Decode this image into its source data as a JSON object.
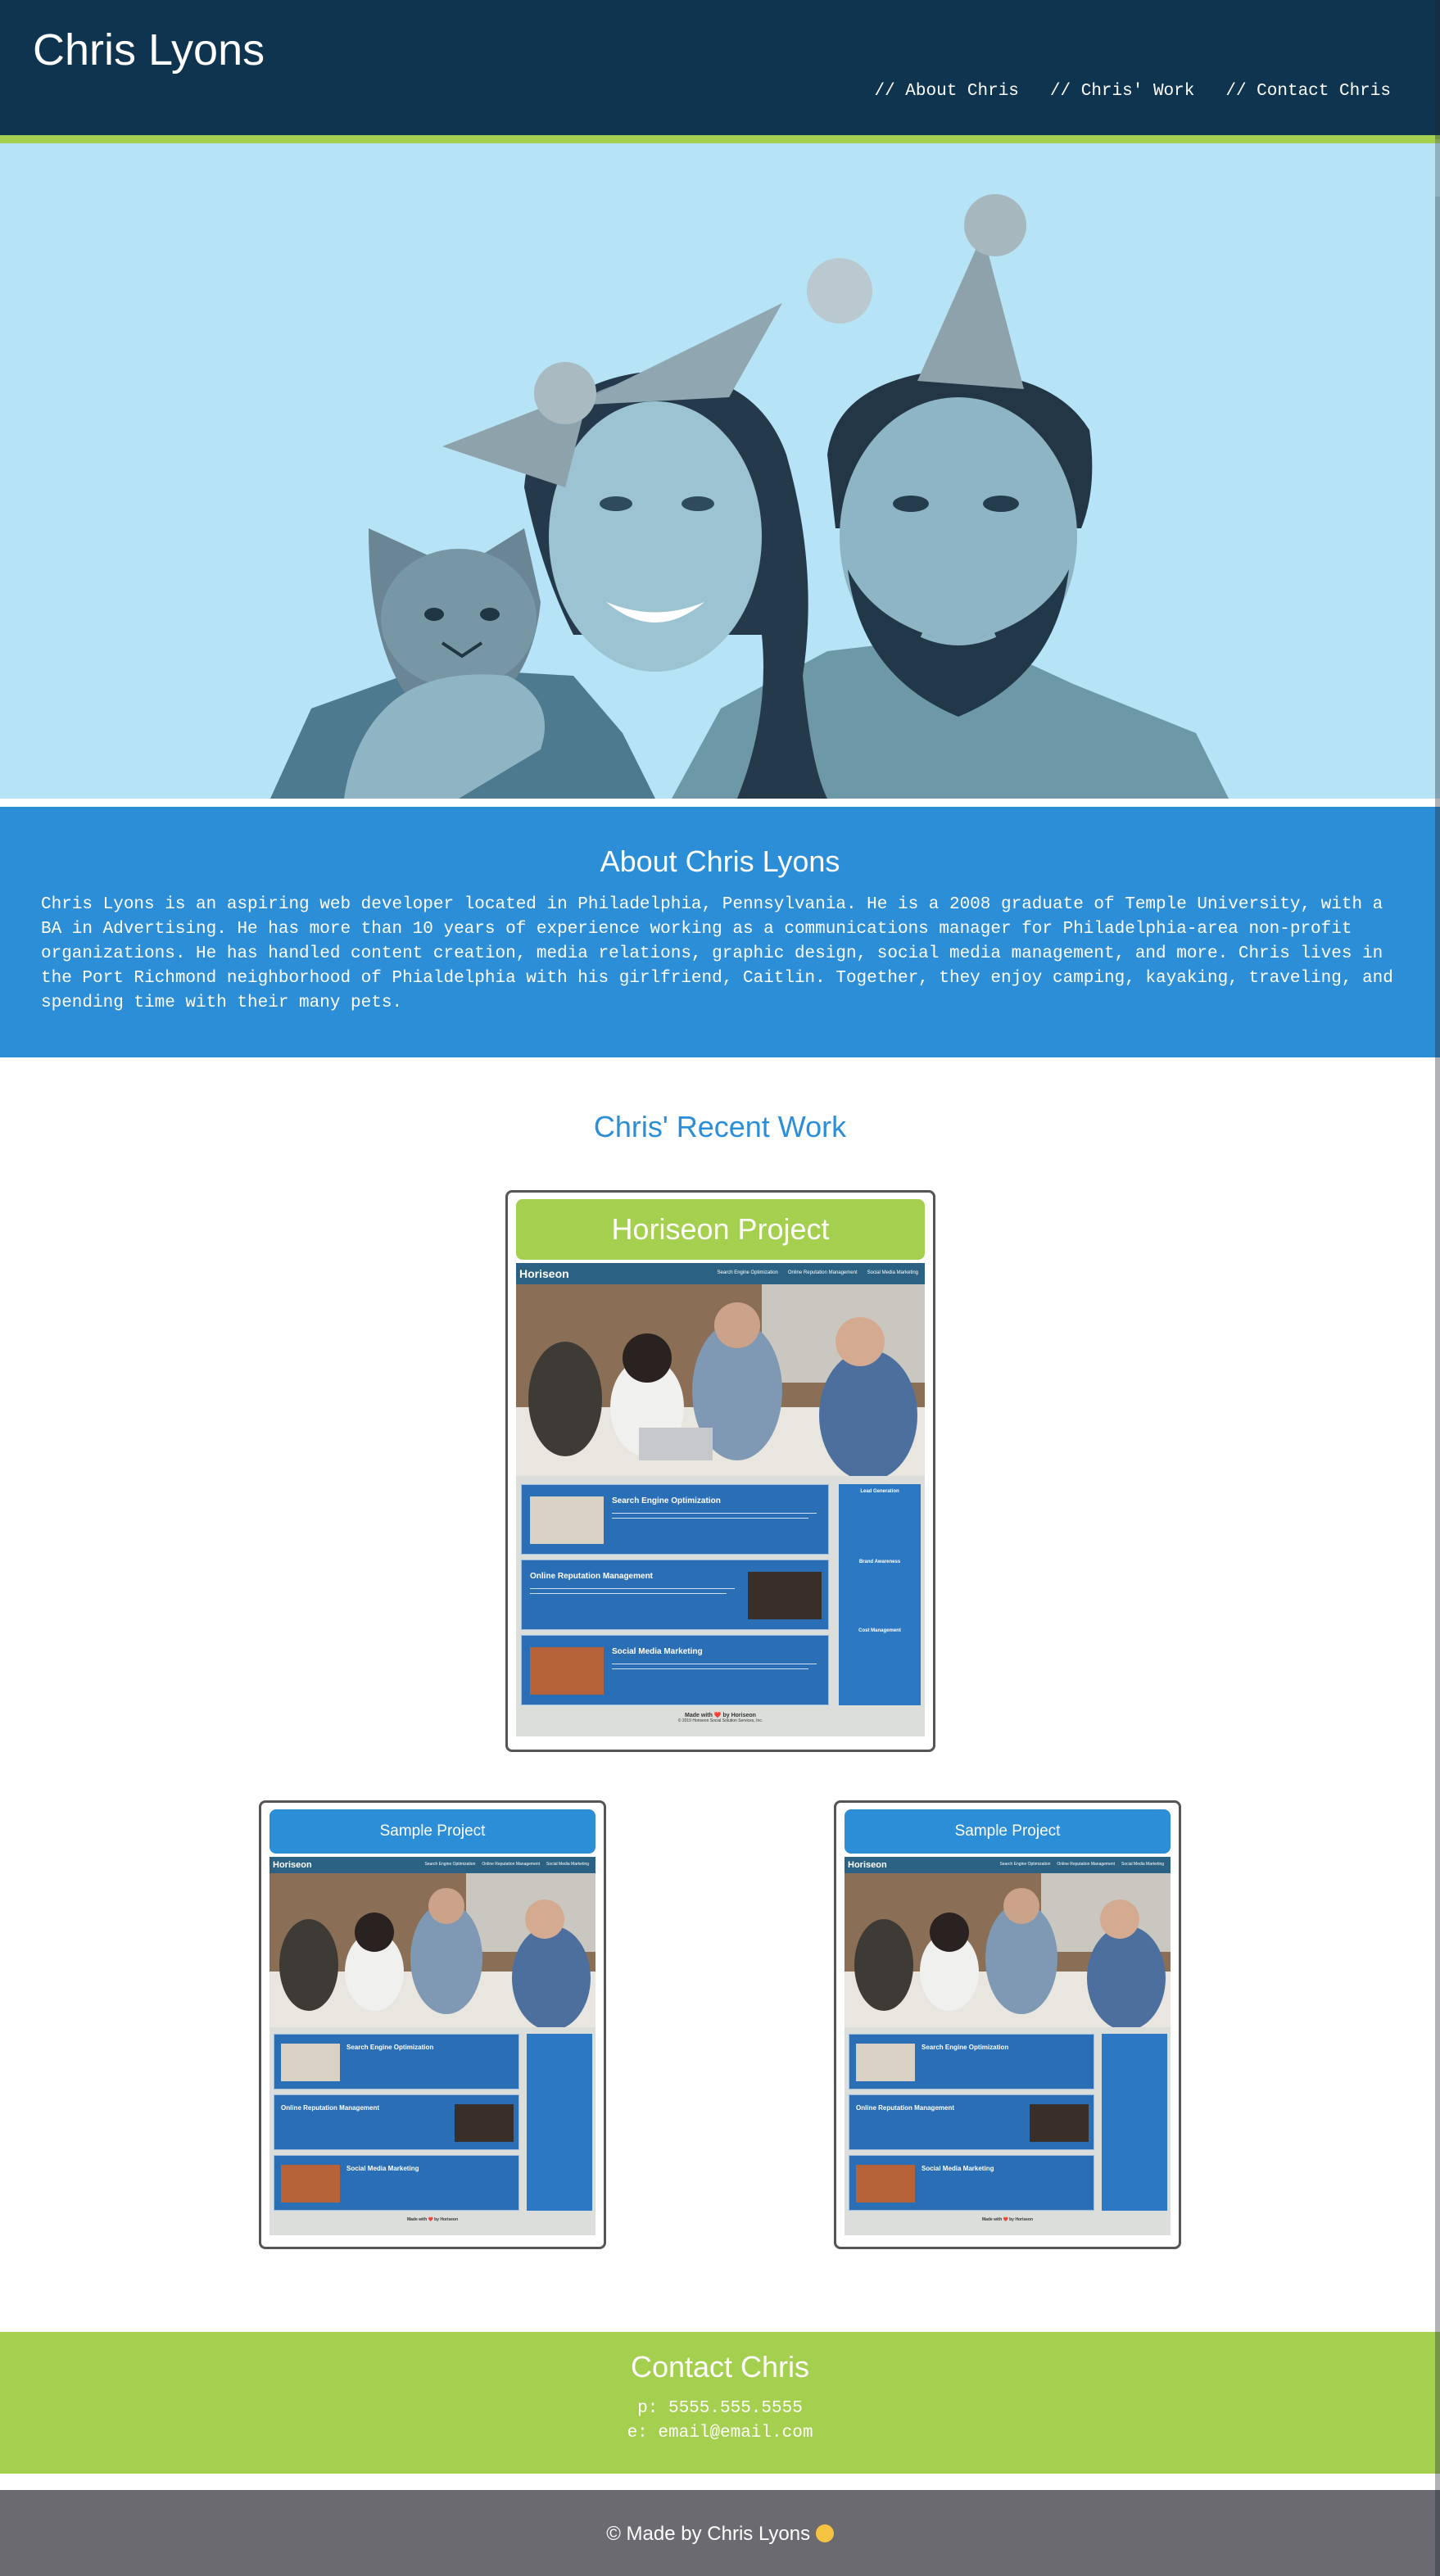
{
  "header": {
    "title": "Chris Lyons",
    "nav": [
      {
        "label": "// About Chris"
      },
      {
        "label": "// Chris' Work"
      },
      {
        "label": "// Contact Chris"
      }
    ]
  },
  "about": {
    "heading": "About Chris Lyons",
    "body": "Chris Lyons is an aspiring web developer located in Philadelphia, Pennsylvania. He is a 2008 graduate of Temple University, with a BA in Advertising. He has more than 10 years of experience working as a communications manager for Philadelphia-area non-profit organizations. He has handled content creation, media relations, graphic design, social media management, and more. Chris lives in the Port Richmond neighborhood of Phialdelphia with his girlfriend, Caitlin. Together, they enjoy camping, kayaking, traveling, and spending time with their many pets."
  },
  "work": {
    "heading": "Chris' Recent Work",
    "projects": [
      {
        "title": "Horiseon Project",
        "color": "#a5d04f"
      },
      {
        "title": "Sample Project",
        "color": "#2d8ed8"
      },
      {
        "title": "Sample Project",
        "color": "#2d8ed8"
      }
    ],
    "screenshot": {
      "logo": "Horiseon",
      "nav": [
        "Search Engine Optimization",
        "Online Reputation Management",
        "Social Media Marketing"
      ],
      "sections": [
        "Search Engine Optimization",
        "Online Reputation Management",
        "Social Media Marketing"
      ],
      "sidebar": [
        "Lead Generation",
        "Brand Awareness",
        "Cost Management"
      ],
      "footer": "Made with ❤️ by Horiseon",
      "copyright": "© 2019 Horiseon Social Solution Services, Inc."
    }
  },
  "contact": {
    "heading": "Contact Chris",
    "phone": "p: 5555.555.5555",
    "email": "e: email@email.com"
  },
  "footer": {
    "text": "© Made by Chris Lyons"
  },
  "colors": {
    "header_bg": "#0f3450",
    "accent_green": "#a5d04f",
    "accent_blue": "#2d8ed8",
    "hero_bg": "#b6e3f5",
    "footer_bg": "#6a6a70"
  }
}
